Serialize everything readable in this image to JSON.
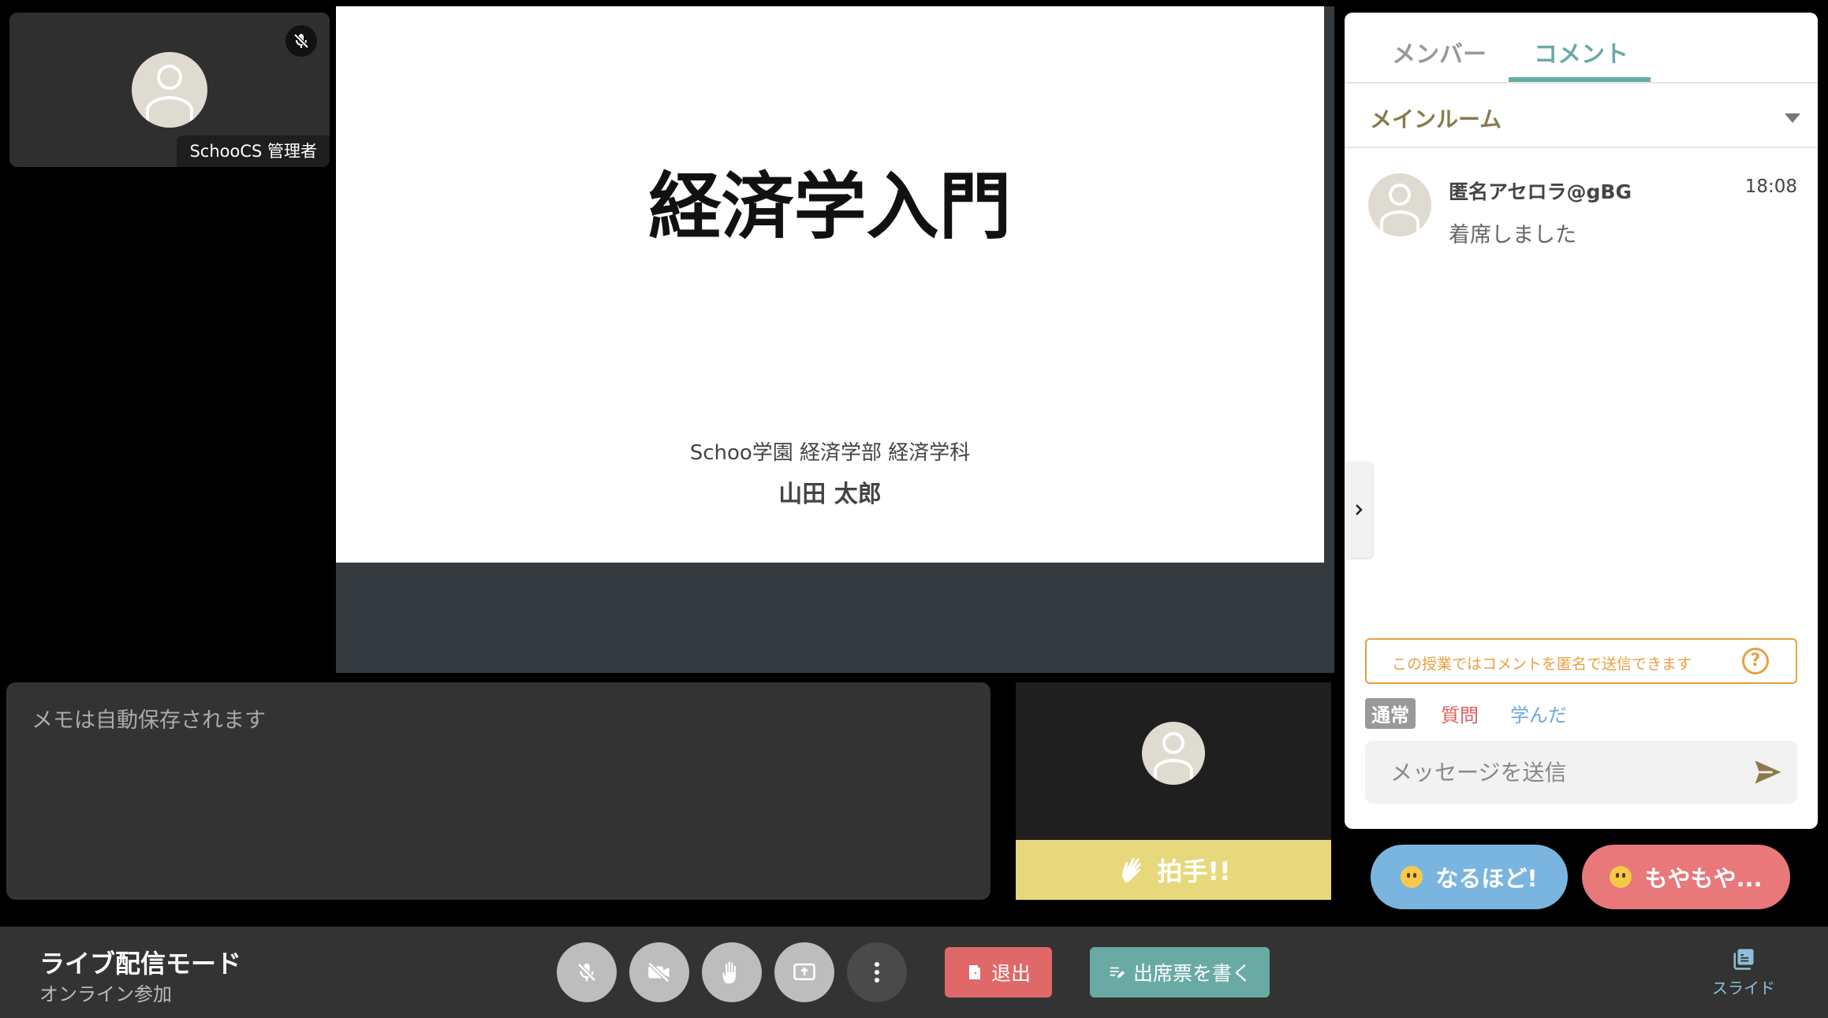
{
  "self_tile": {
    "name": "SchooCS 管理者"
  },
  "slide": {
    "title": "経済学入門",
    "organization": "Schoo学園 経済学部 経済学科",
    "author": "山田 太郎"
  },
  "memo": {
    "placeholder": "メモは自動保存されます"
  },
  "clap": {
    "label": "拍手!!"
  },
  "panel": {
    "tabs": [
      {
        "label": "メンバー"
      },
      {
        "label": "コメント"
      }
    ],
    "room": "メインルーム",
    "comments": [
      {
        "author": "匿名アセロラ@gBG",
        "time": "18:08",
        "text": "着席しました"
      }
    ],
    "anon_notice": "この授業ではコメントを匿名で送信できます",
    "help_glyph": "?",
    "modes": {
      "normal": "通常",
      "question": "質問",
      "learned": "学んだ"
    },
    "message_placeholder": "メッセージを送信"
  },
  "reactions": {
    "naruhodo": "なるほど!",
    "moyamoya": "もやもや..."
  },
  "bottom_bar": {
    "mode_title": "ライブ配信モード",
    "mode_sub": "オンライン参加",
    "leave": "退出",
    "attendance": "出席票を書く",
    "slides": "スライド"
  },
  "colors": {
    "accent_teal": "#6aaaa5",
    "leave_red": "#e06868",
    "clap_yellow": "#e8d87c",
    "notice_orange": "#e8a040",
    "naruhodo_blue": "#7ab5e0",
    "moyamoya_red": "#e8787a"
  }
}
